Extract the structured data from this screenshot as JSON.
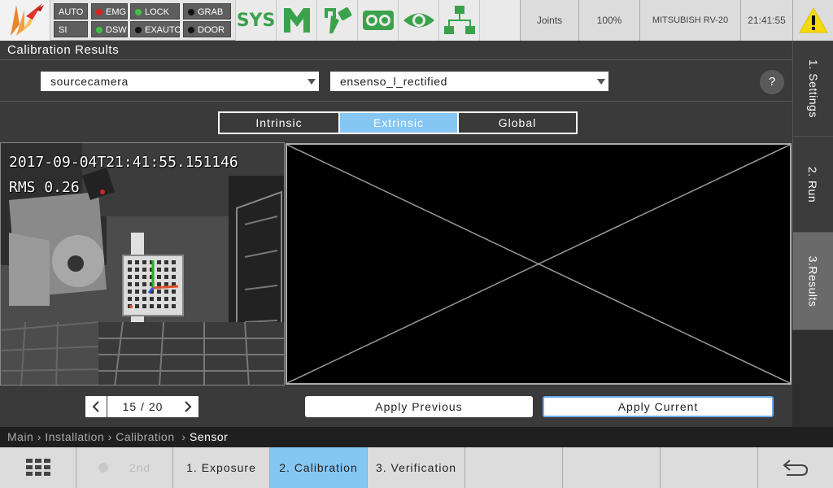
{
  "topbar": {
    "status": {
      "auto": "AUTO",
      "si": "SI",
      "emg": "EMG",
      "dsw": "DSW",
      "lock": "LOCK",
      "exauto": "EXAUTO",
      "grab": "GRAB",
      "door": "DOOR"
    },
    "status_colors": {
      "emg": "#e02020",
      "dsw": "#3fc04a",
      "lock": "#3fc04a",
      "exauto": "#111111",
      "grab": "#111111",
      "door": "#111111"
    },
    "sys_label": "SYS",
    "icons": [
      "gripper-m-icon",
      "tool-icon",
      "stereo-camera-icon",
      "eye-icon",
      "network-tree-icon"
    ],
    "joints_label": "Joints",
    "speed": "100%",
    "robot": "MITSUBISH RV-20",
    "clock": "21:41:55",
    "accent_green": "#3aa24c"
  },
  "section_title": "Calibration Results",
  "source_dropdown": "sourcecamera",
  "target_dropdown": "ensenso_l_rectified",
  "help_label": "?",
  "mode_tabs": [
    {
      "label": "Intrinsic",
      "active": false
    },
    {
      "label": "Extrinsic",
      "active": true
    },
    {
      "label": "Global",
      "active": false
    }
  ],
  "camera_overlay": {
    "timestamp": "2017-09-04T21:41:55.151146",
    "rms": "RMS 0.26"
  },
  "pager": {
    "count": "15 / 20"
  },
  "buttons": {
    "apply_previous": "Apply Previous",
    "apply_current": "Apply Current"
  },
  "right_tabs": [
    {
      "label": "1. Settings",
      "active": false
    },
    {
      "label": "2. Run",
      "active": false
    },
    {
      "label": "3.Results",
      "active": true
    }
  ],
  "breadcrumb": {
    "items": [
      "Main",
      "Installation",
      "Calibration"
    ],
    "current": "Sensor"
  },
  "bottom_nav": {
    "second_label": "2nd",
    "items": [
      {
        "label": "1. Exposure",
        "active": false
      },
      {
        "label": "2. Calibration",
        "active": true
      },
      {
        "label": "3. Verification",
        "active": false
      }
    ]
  },
  "colors": {
    "active_tab": "#86c6f2",
    "background": "#3a3a3a",
    "warning": "#f5d90a"
  }
}
